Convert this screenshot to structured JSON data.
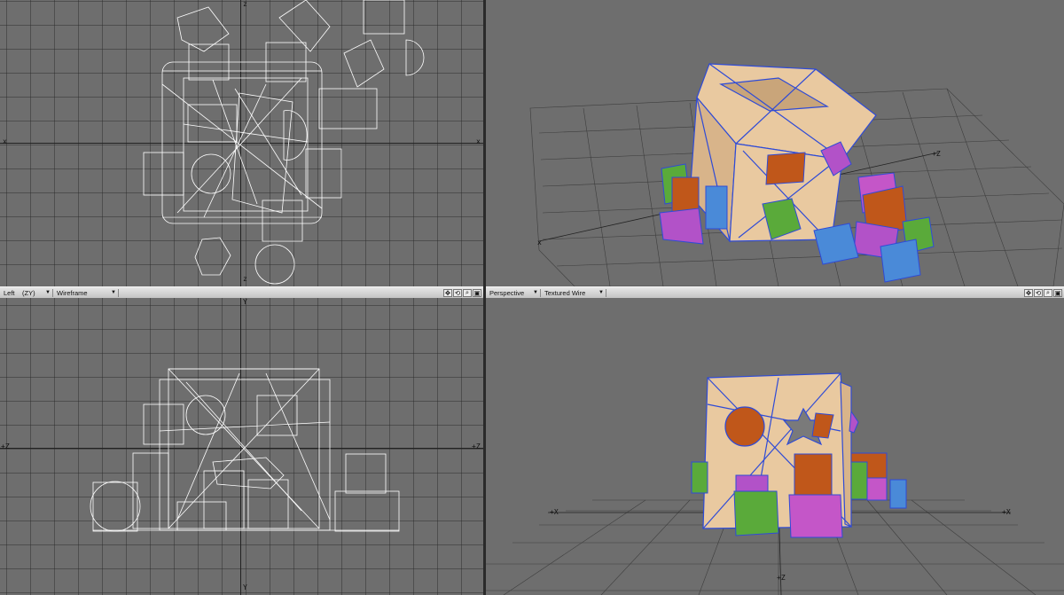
{
  "viewports": {
    "top_left": {
      "axis_labels": {
        "left": "x",
        "right": "x",
        "top": "z",
        "bottom": "z"
      }
    },
    "top_right": {
      "axis_labels": {
        "z": "+Z",
        "x": "x"
      }
    },
    "bottom_left": {
      "header": {
        "view": "Left",
        "plane": "(ZY)",
        "mode": "Wireframe"
      },
      "axis_labels": {
        "left": "+Z",
        "right": "+Z",
        "top": "Y",
        "bottom": "Y"
      }
    },
    "bottom_right": {
      "header": {
        "view": "Perspective",
        "mode": "Textured Wire"
      },
      "axis_labels": {
        "left": "+X",
        "right": "+X",
        "bottom": "+Z"
      }
    }
  },
  "icons": [
    "move-icon",
    "rotate-icon",
    "zoom-icon",
    "maximize-icon"
  ],
  "colors": {
    "viewport_bg": "#6e6e6e",
    "wire": "#ffffff",
    "box_fill": "#e9c9a0",
    "box_edge": "#2f4bd6",
    "orange_block": "#c0571a",
    "purple_block": "#b252c8",
    "green_block": "#5aaa3a",
    "blue_block": "#4a8ad8",
    "magenta_block": "#c456c8"
  }
}
